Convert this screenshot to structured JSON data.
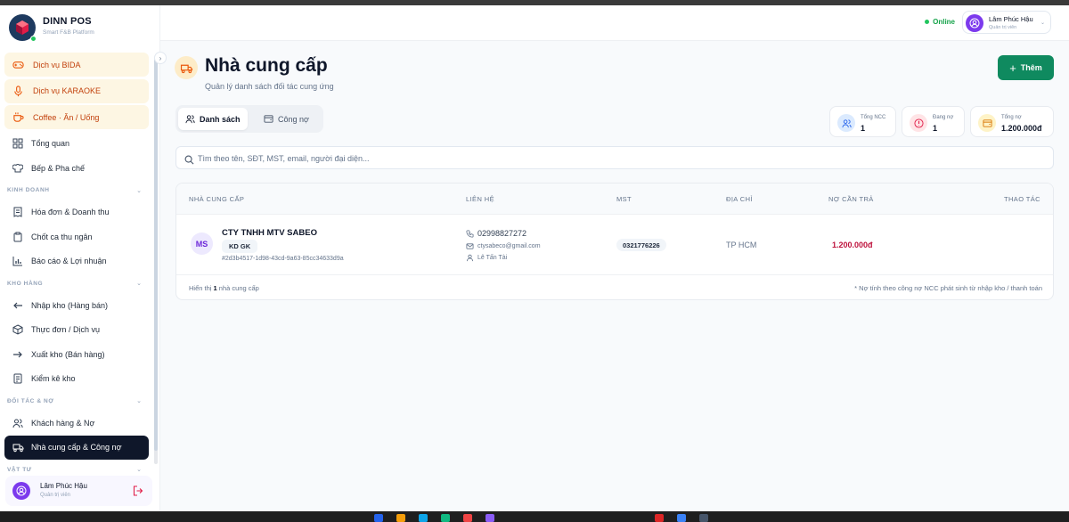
{
  "brand": {
    "name": "DINN POS",
    "tagline": "Smart F&B Platform"
  },
  "sidebar": {
    "services": [
      {
        "label": "Dịch vụ BIDA",
        "icon": "gamepad-icon"
      },
      {
        "label": "Dịch vụ KARAOKE",
        "icon": "microphone-icon"
      },
      {
        "label": "Coffee · Ăn / Uống",
        "icon": "coffee-icon"
      }
    ],
    "top_items": [
      {
        "label": "Tổng quan",
        "icon": "grid-icon"
      },
      {
        "label": "Bếp & Pha chế",
        "icon": "chef-hat-icon"
      }
    ],
    "sections": [
      {
        "label": "KINH DOANH",
        "items": [
          {
            "label": "Hóa đơn & Doanh thu",
            "icon": "receipt-icon"
          },
          {
            "label": "Chốt ca thu ngân",
            "icon": "clipboard-icon"
          },
          {
            "label": "Báo cáo & Lợi nhuận",
            "icon": "bar-chart-icon"
          }
        ]
      },
      {
        "label": "KHO HÀNG",
        "items": [
          {
            "label": "Nhập kho (Hàng bán)",
            "icon": "arrow-in-icon"
          },
          {
            "label": "Thực đơn / Dịch vụ",
            "icon": "box-icon"
          },
          {
            "label": "Xuất kho (Bán hàng)",
            "icon": "arrow-out-icon"
          },
          {
            "label": "Kiểm kê kho",
            "icon": "checklist-icon"
          }
        ]
      },
      {
        "label": "ĐỐI TÁC & NỢ",
        "items": [
          {
            "label": "Khách hàng & Nợ",
            "icon": "users-icon"
          },
          {
            "label": "Nhà cung cấp & Công nợ",
            "icon": "truck-icon",
            "active": true
          }
        ]
      },
      {
        "label": "VẬT TƯ",
        "items": []
      }
    ],
    "user": {
      "name": "Lâm Phúc Hậu",
      "role": "Quản trị viên"
    }
  },
  "topbar": {
    "status": "Online",
    "user": {
      "name": "Lâm Phúc Hậu",
      "role": "Quản trị viên"
    }
  },
  "page": {
    "title": "Nhà cung cấp",
    "subtitle": "Quản lý danh sách đối tác cung ứng",
    "add_label": "Thêm",
    "tabs": [
      {
        "label": "Danh sách",
        "active": true
      },
      {
        "label": "Công nợ",
        "active": false
      }
    ],
    "stats": [
      {
        "label": "Tổng NCC",
        "value": "1",
        "icon": "users-icon",
        "color": "#dbeafe",
        "icolor": "#2563eb"
      },
      {
        "label": "Đang nợ",
        "value": "1",
        "icon": "alert-circle-icon",
        "color": "#ffe4e6",
        "icolor": "#e11d48"
      },
      {
        "label": "Tổng nợ",
        "value": "1.200.000đ",
        "icon": "wallet-icon",
        "color": "#fef3c7",
        "icolor": "#d97706"
      }
    ],
    "search_placeholder": "Tìm theo tên, SĐT, MST, email, người đại diện...",
    "table": {
      "headers": [
        "NHÀ CUNG CẤP",
        "LIÊN HỆ",
        "MST",
        "ĐỊA CHỈ",
        "NỢ CẦN TRẢ",
        "THAO TÁC"
      ],
      "rows": [
        {
          "initials": "MS",
          "name": "CTY TNHH MTV SABEO",
          "tag": "KD GK",
          "id": "#2d3b4517-1d98-43cd-9a63-85cc34633d9a",
          "phone": "02998827272",
          "email": "ctysabeco@gmail.com",
          "representative": "Lê Tấn Tài",
          "mst": "0321776226",
          "address": "TP HCM",
          "debt": "1.200.000đ"
        }
      ],
      "footer_prefix": "Hiển thị",
      "footer_count": "1",
      "footer_suffix": "nhà cung cấp",
      "footer_note": "* Nợ tính theo công nợ NCC phát sinh từ nhập kho / thanh toán"
    }
  },
  "colors": {
    "accent": "#0f8a5f",
    "active_nav": "#0f172a",
    "debt": "#be123c",
    "service_bg": "#fdf6e3"
  }
}
